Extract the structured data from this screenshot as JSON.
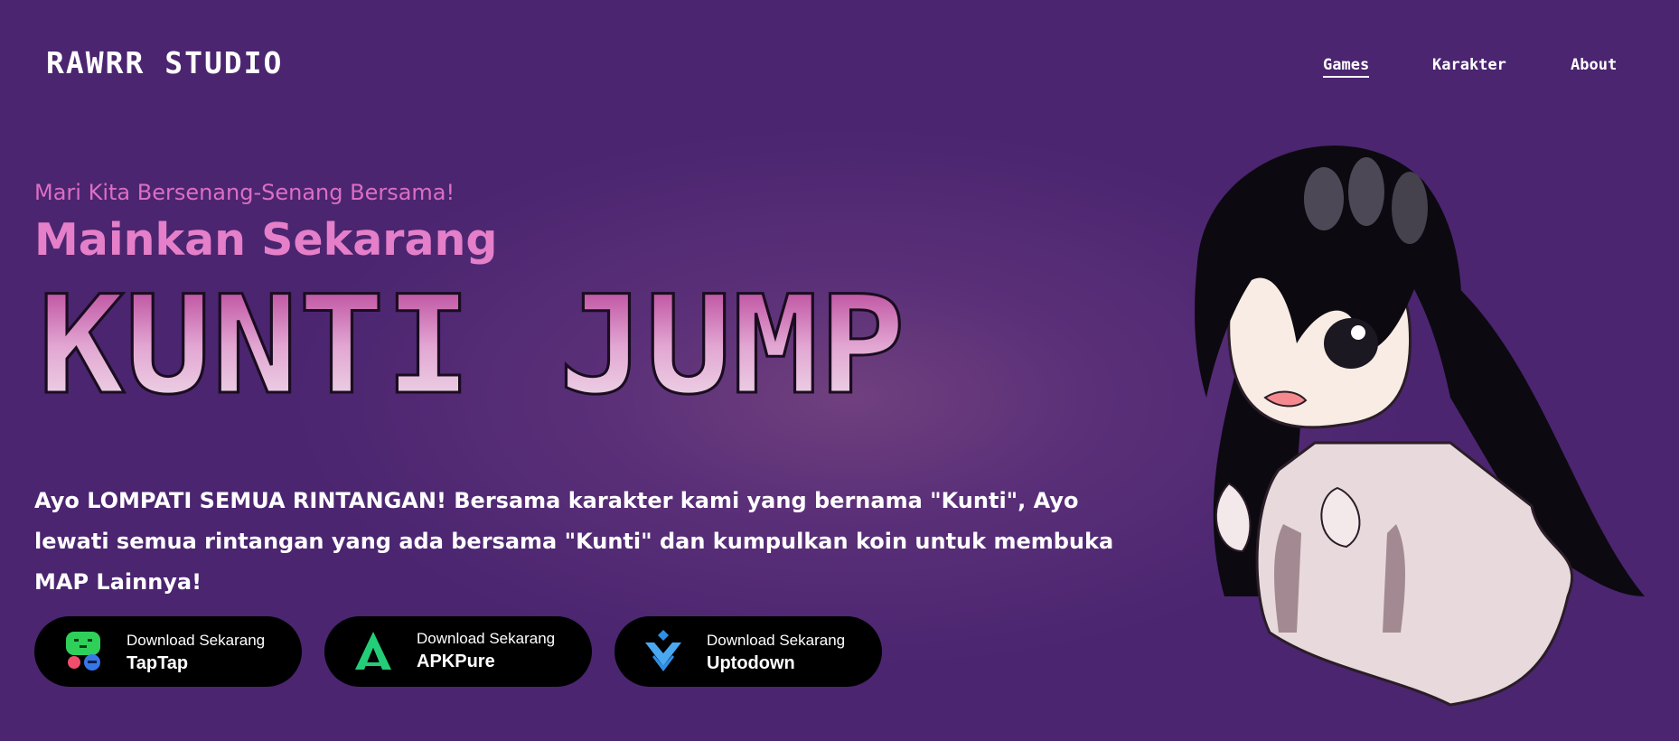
{
  "header": {
    "brand": "RAWRR STUDIO",
    "nav": [
      {
        "label": "Games",
        "active": true
      },
      {
        "label": "Karakter",
        "active": false
      },
      {
        "label": "About",
        "active": false
      }
    ]
  },
  "hero": {
    "tagline": "Mari Kita Bersenang-Senang Bersama!",
    "headline": "Mainkan Sekarang",
    "game_title": "KUNTI JUMP",
    "description": "Ayo LOMPATI SEMUA RINTANGAN! Bersama karakter kami yang bernama \"Kunti\", Ayo lewati semua rintangan yang ada bersama \"Kunti\" dan kumpulkan koin untuk membuka MAP Lainnya!"
  },
  "downloads": [
    {
      "line1": "Download Sekarang",
      "store": "TapTap",
      "icon": "taptap-icon"
    },
    {
      "line1": "Download Sekarang",
      "store": "APKPure",
      "icon": "apkpure-icon"
    },
    {
      "line1": "Download Sekarang",
      "store": "Uptodown",
      "icon": "uptodown-icon"
    }
  ],
  "colors": {
    "background": "#4b2570",
    "accent_pink": "#e57fc9",
    "button_bg": "#000000"
  },
  "illustration": "kunti-ghost-character"
}
